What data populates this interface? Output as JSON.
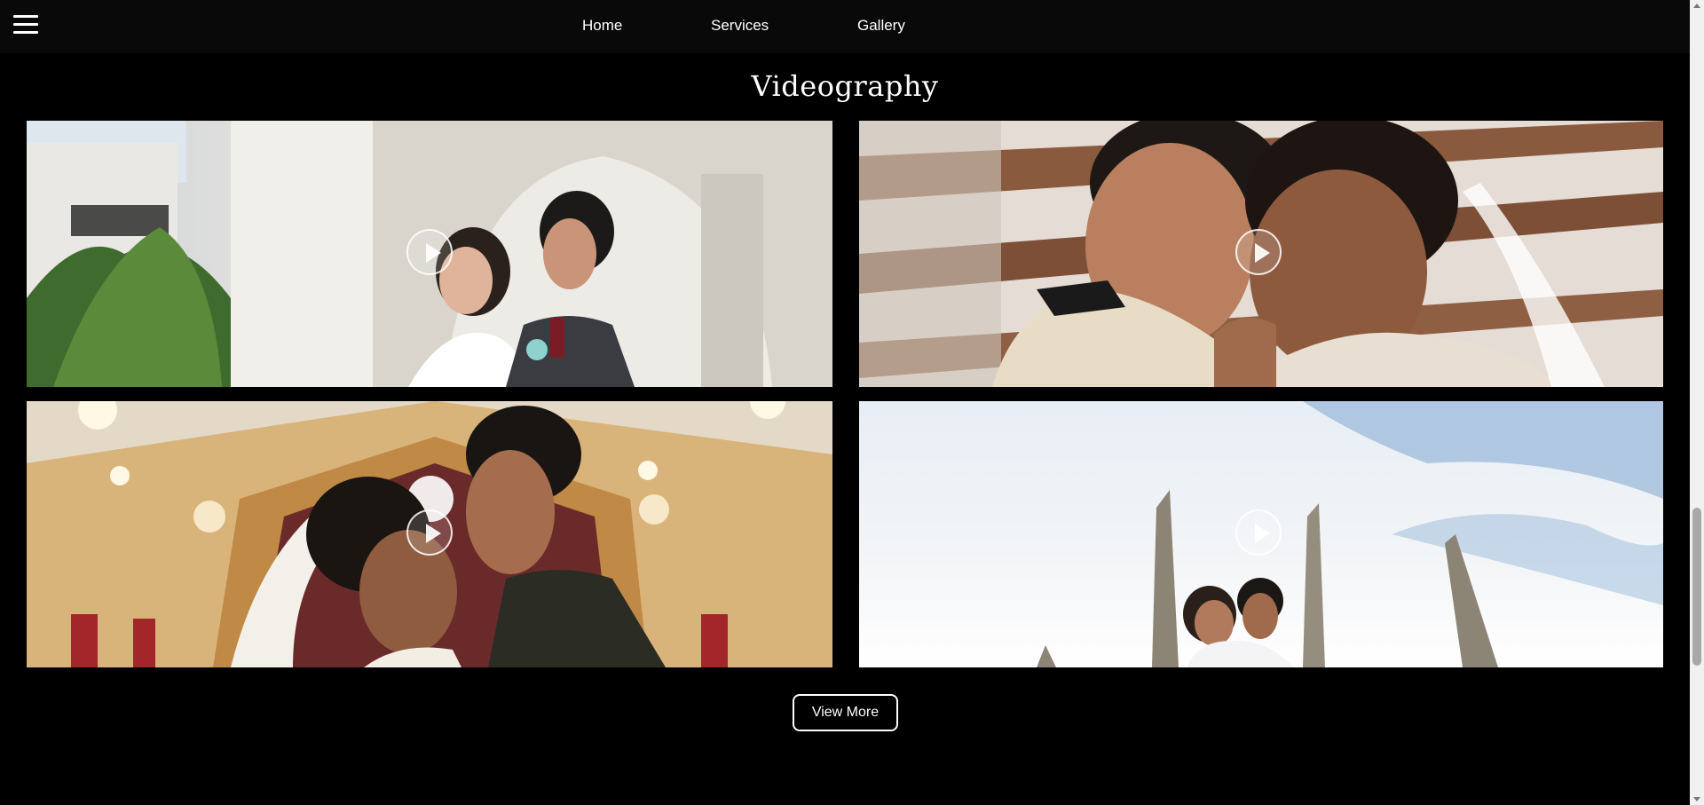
{
  "nav": {
    "menu_icon": "hamburger-menu-icon",
    "links": [
      "Home",
      "Services",
      "Gallery"
    ]
  },
  "section": {
    "title": "Videography"
  },
  "videos": [
    {
      "name": "video-thumbnail-1",
      "icon": "play-icon"
    },
    {
      "name": "video-thumbnail-2",
      "icon": "play-icon"
    },
    {
      "name": "video-thumbnail-3",
      "icon": "play-icon"
    },
    {
      "name": "video-thumbnail-4",
      "icon": "play-icon"
    }
  ],
  "actions": {
    "view_more_label": "View More"
  },
  "colors": {
    "background": "#000000",
    "topbar": "#090909",
    "text": "#ffffff"
  }
}
